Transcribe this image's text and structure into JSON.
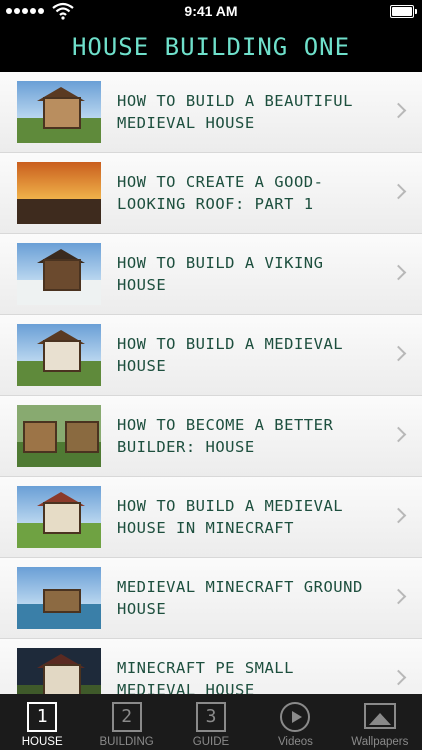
{
  "status_bar": {
    "time": "9:41 AM"
  },
  "nav": {
    "title": "HOUSE BUILDING ONE"
  },
  "list": {
    "items": [
      {
        "title": "HOW TO BUILD A BEAUTIFUL MEDIEVAL HOUSE"
      },
      {
        "title": "HOW TO CREATE A GOOD-LOOKING ROOF: PART 1"
      },
      {
        "title": "HOW TO BUILD A VIKING HOUSE"
      },
      {
        "title": "HOW TO BUILD A MEDIEVAL HOUSE"
      },
      {
        "title": "HOW TO BECOME A BETTER BUILDER: HOUSE"
      },
      {
        "title": "HOW TO BUILD A MEDIEVAL HOUSE IN MINECRAFT"
      },
      {
        "title": "MEDIEVAL MINECRAFT GROUND HOUSE"
      },
      {
        "title": "MINECRAFT PE SMALL MEDIEVAL HOUSE"
      }
    ]
  },
  "tabs": {
    "house": {
      "label": "HOUSE",
      "glyph": "1"
    },
    "building": {
      "label": "BUILDING",
      "glyph": "2"
    },
    "guide": {
      "label": "GUIDE",
      "glyph": "3"
    },
    "videos": {
      "label": "Videos"
    },
    "wallpapers": {
      "label": "Wallpapers"
    }
  },
  "colors": {
    "accent": "#6fe0cb",
    "title_text": "#1d4f3e"
  }
}
